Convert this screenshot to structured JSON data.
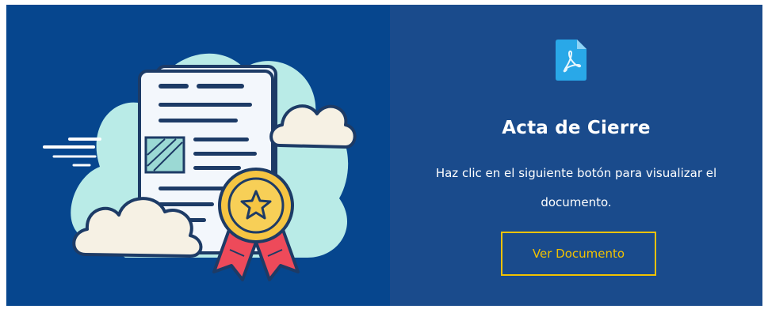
{
  "card": {
    "title": "Acta de Cierre",
    "description": "Haz clic en el siguiente botón para visualizar el documento.",
    "button_label": "Ver Documento",
    "file_icon": "pdf-file-icon"
  },
  "colors": {
    "left_background": "#06468e",
    "right_background": "#1a4b8c",
    "accent_yellow": "#f2c200",
    "cloud_teal": "#b9ebe7",
    "badge_gold": "#f5c542",
    "ribbon_red": "#ee4a5a",
    "pdf_blue": "#29a8e8"
  },
  "illustration": {
    "name": "document-certificate-illustration",
    "elements": [
      "cloud",
      "document-sheet",
      "award-medal-icon",
      "star-icon",
      "ribbon",
      "speed-lines"
    ]
  }
}
